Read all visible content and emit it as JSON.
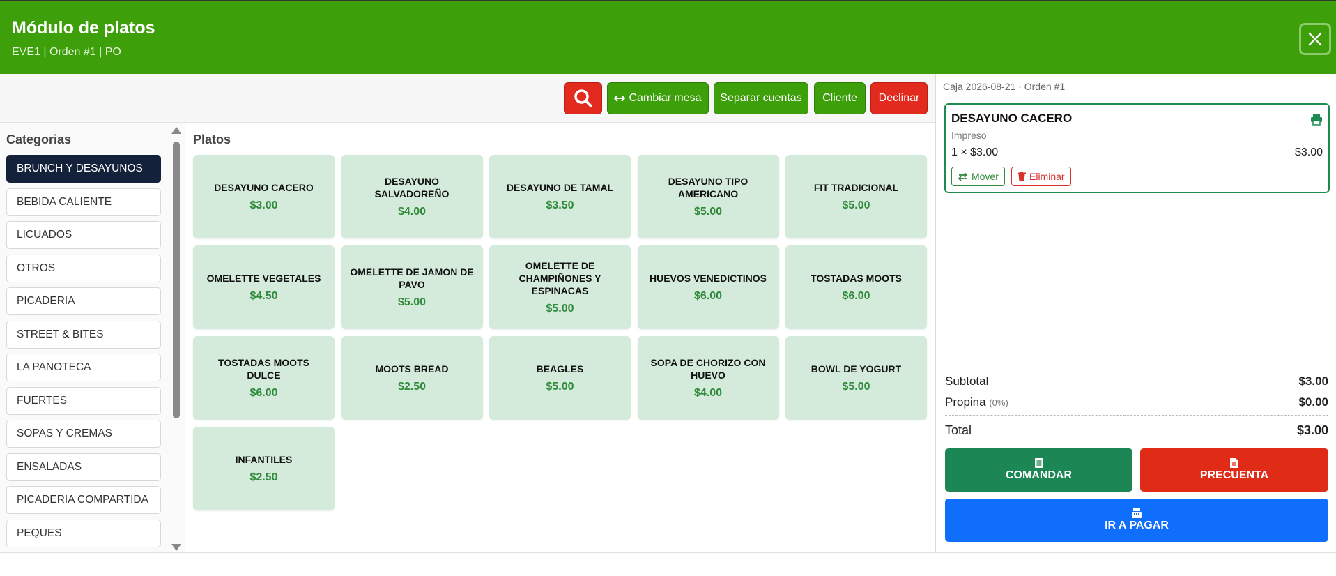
{
  "header": {
    "title": "Módulo de platos",
    "subtitle": "EVE1 | Orden #1 | PO"
  },
  "toolbar": {
    "cambiar_mesa": "Cambiar mesa",
    "separar_cuentas": "Separar cuentas",
    "cliente": "Cliente",
    "declinar": "Declinar"
  },
  "categories": {
    "title": "Categorias",
    "items": [
      "BRUNCH Y DESAYUNOS",
      "BEBIDA CALIENTE",
      "LICUADOS",
      "OTROS",
      "PICADERIA",
      "STREET & BITES",
      "LA PANOTECA",
      "FUERTES",
      "SOPAS Y CREMAS",
      "ENSALADAS",
      "PICADERIA COMPARTIDA",
      "PEQUES"
    ],
    "active": "BRUNCH Y DESAYUNOS"
  },
  "dishes": {
    "title": "Platos",
    "items": [
      {
        "name": "DESAYUNO CACERO",
        "price": "$3.00"
      },
      {
        "name": "DESAYUNO SALVADOREÑO",
        "price": "$4.00"
      },
      {
        "name": "DESAYUNO DE TAMAL",
        "price": "$3.50"
      },
      {
        "name": "DESAYUNO TIPO AMERICANO",
        "price": "$5.00"
      },
      {
        "name": "FIT TRADICIONAL",
        "price": "$5.00"
      },
      {
        "name": "OMELETTE VEGETALES",
        "price": "$4.50"
      },
      {
        "name": "OMELETTE DE JAMON DE PAVO",
        "price": "$5.00"
      },
      {
        "name": "OMELETTE DE CHAMPIÑONES Y ESPINACAS",
        "price": "$5.00"
      },
      {
        "name": "HUEVOS VENEDICTINOS",
        "price": "$6.00"
      },
      {
        "name": "TOSTADAS MOOTS",
        "price": "$6.00"
      },
      {
        "name": "TOSTADAS MOOTS DULCE",
        "price": "$6.00"
      },
      {
        "name": "MOOTS BREAD",
        "price": "$2.50"
      },
      {
        "name": "BEAGLES",
        "price": "$5.00"
      },
      {
        "name": "SOPA DE CHORIZO CON HUEVO",
        "price": "$4.00"
      },
      {
        "name": "BOWL DE YOGURT",
        "price": "$5.00"
      },
      {
        "name": "INFANTILES",
        "price": "$2.50"
      }
    ]
  },
  "order": {
    "caja": "Caja 2026-08-21 · Orden #1",
    "item": {
      "name": "DESAYUNO CACERO",
      "status": "Impreso",
      "qty_line": "1 × $3.00",
      "total": "$3.00",
      "move_label": "Mover",
      "delete_label": "Eliminar"
    },
    "subtotal_label": "Subtotal",
    "subtotal": "$3.00",
    "propina_label": "Propina",
    "propina_pct": "(0%)",
    "propina": "$0.00",
    "total_label": "Total",
    "total": "$3.00",
    "comandar": "COMANDAR",
    "precuenta": "PRECUENTA",
    "pagar": "IR A PAGAR"
  },
  "colors": {
    "header": "#3d9f0a",
    "active_category": "#14213a",
    "dish_bg": "#d4eadb",
    "price": "#2f8a3a",
    "comandar": "#1c8654",
    "precuenta": "#e02b17",
    "pagar": "#0f6efc"
  }
}
